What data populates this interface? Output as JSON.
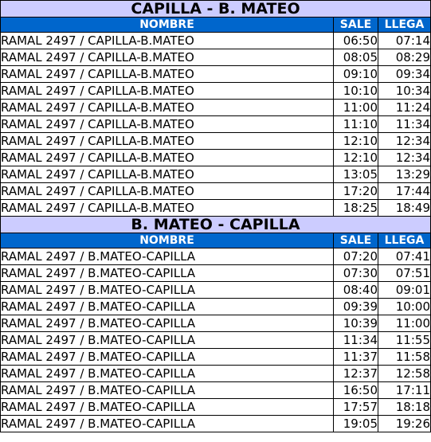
{
  "colors": {
    "title_bg": "#ccccff",
    "header_bg": "#0066cc",
    "header_text": "#ffffff"
  },
  "sections": [
    {
      "title": "CAPILLA - B. MATEO",
      "headers": {
        "name": "NOMBRE",
        "sale": "SALE",
        "llega": "LLEGA"
      },
      "rows": [
        {
          "name": "RAMAL 2497 / CAPILLA-B.MATEO",
          "sale": "06:50",
          "llega": "07:14"
        },
        {
          "name": "RAMAL 2497 / CAPILLA-B.MATEO",
          "sale": "08:05",
          "llega": "08:29"
        },
        {
          "name": "RAMAL 2497 / CAPILLA-B.MATEO",
          "sale": "09:10",
          "llega": "09:34"
        },
        {
          "name": "RAMAL 2497 / CAPILLA-B.MATEO",
          "sale": "10:10",
          "llega": "10:34"
        },
        {
          "name": "RAMAL 2497 / CAPILLA-B.MATEO",
          "sale": "11:00",
          "llega": "11:24"
        },
        {
          "name": "RAMAL 2497 / CAPILLA-B.MATEO",
          "sale": "11:10",
          "llega": "11:34"
        },
        {
          "name": "RAMAL 2497 / CAPILLA-B.MATEO",
          "sale": "12:10",
          "llega": "12:34"
        },
        {
          "name": "RAMAL 2497 / CAPILLA-B.MATEO",
          "sale": "12:10",
          "llega": "12:34"
        },
        {
          "name": "RAMAL 2497 / CAPILLA-B.MATEO",
          "sale": "13:05",
          "llega": "13:29"
        },
        {
          "name": "RAMAL 2497 / CAPILLA-B.MATEO",
          "sale": "17:20",
          "llega": "17:44"
        },
        {
          "name": "RAMAL 2497 / CAPILLA-B.MATEO",
          "sale": "18:25",
          "llega": "18:49"
        }
      ]
    },
    {
      "title": "B. MATEO - CAPILLA",
      "headers": {
        "name": "NOMBRE",
        "sale": "SALE",
        "llega": "LLEGA"
      },
      "rows": [
        {
          "name": "RAMAL 2497 / B.MATEO-CAPILLA",
          "sale": "07:20",
          "llega": "07:41"
        },
        {
          "name": "RAMAL 2497 / B.MATEO-CAPILLA",
          "sale": "07:30",
          "llega": "07:51"
        },
        {
          "name": "RAMAL 2497 / B.MATEO-CAPILLA",
          "sale": "08:40",
          "llega": "09:01"
        },
        {
          "name": "RAMAL 2497 / B.MATEO-CAPILLA",
          "sale": "09:39",
          "llega": "10:00"
        },
        {
          "name": "RAMAL 2497 / B.MATEO-CAPILLA",
          "sale": "10:39",
          "llega": "11:00"
        },
        {
          "name": "RAMAL 2497 / B.MATEO-CAPILLA",
          "sale": "11:34",
          "llega": "11:55"
        },
        {
          "name": "RAMAL 2497 / B.MATEO-CAPILLA",
          "sale": "11:37",
          "llega": "11:58"
        },
        {
          "name": "RAMAL 2497 / B.MATEO-CAPILLA",
          "sale": "12:37",
          "llega": "12:58"
        },
        {
          "name": "RAMAL 2497 / B.MATEO-CAPILLA",
          "sale": "16:50",
          "llega": "17:11"
        },
        {
          "name": "RAMAL 2497 / B.MATEO-CAPILLA",
          "sale": "17:57",
          "llega": "18:18"
        },
        {
          "name": "RAMAL 2497 / B.MATEO-CAPILLA",
          "sale": "19:05",
          "llega": "19:26"
        }
      ]
    }
  ]
}
